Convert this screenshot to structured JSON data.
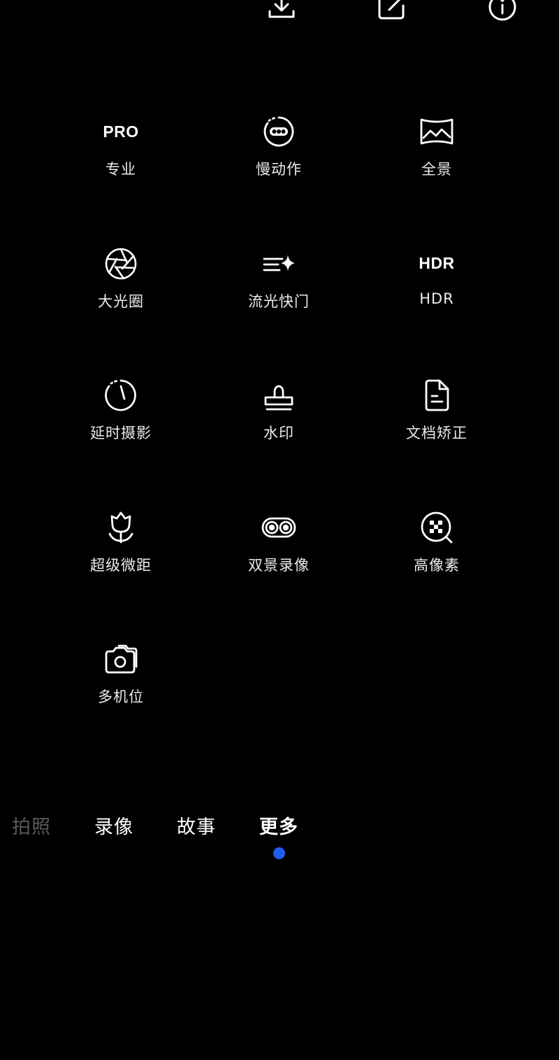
{
  "colors": {
    "background": "#000000",
    "icon": "#ffffff",
    "active_indicator": "#1f5cf0"
  },
  "top_actions": [
    {
      "name": "download-icon"
    },
    {
      "name": "edit-icon"
    },
    {
      "name": "info-icon"
    }
  ],
  "modes": [
    {
      "label": "专业",
      "icon": "pro-text-icon",
      "icon_text": "PRO"
    },
    {
      "label": "慢动作",
      "icon": "slow-motion-icon"
    },
    {
      "label": "全景",
      "icon": "panorama-icon"
    },
    {
      "label": "大光圈",
      "icon": "aperture-icon"
    },
    {
      "label": "流光快门",
      "icon": "light-trails-icon"
    },
    {
      "label": "HDR",
      "icon": "hdr-text-icon",
      "icon_text": "HDR"
    },
    {
      "label": "延时摄影",
      "icon": "timelapse-icon"
    },
    {
      "label": "水印",
      "icon": "stamp-icon"
    },
    {
      "label": "文档矫正",
      "icon": "document-icon"
    },
    {
      "label": "超级微距",
      "icon": "flower-icon"
    },
    {
      "label": "双景录像",
      "icon": "dual-view-icon"
    },
    {
      "label": "高像素",
      "icon": "high-res-icon"
    },
    {
      "label": "多机位",
      "icon": "multi-camera-icon"
    }
  ],
  "tabs": [
    {
      "label": "拍照",
      "state": "dim"
    },
    {
      "label": "录像",
      "state": "normal"
    },
    {
      "label": "故事",
      "state": "normal"
    },
    {
      "label": "更多",
      "state": "active"
    }
  ]
}
